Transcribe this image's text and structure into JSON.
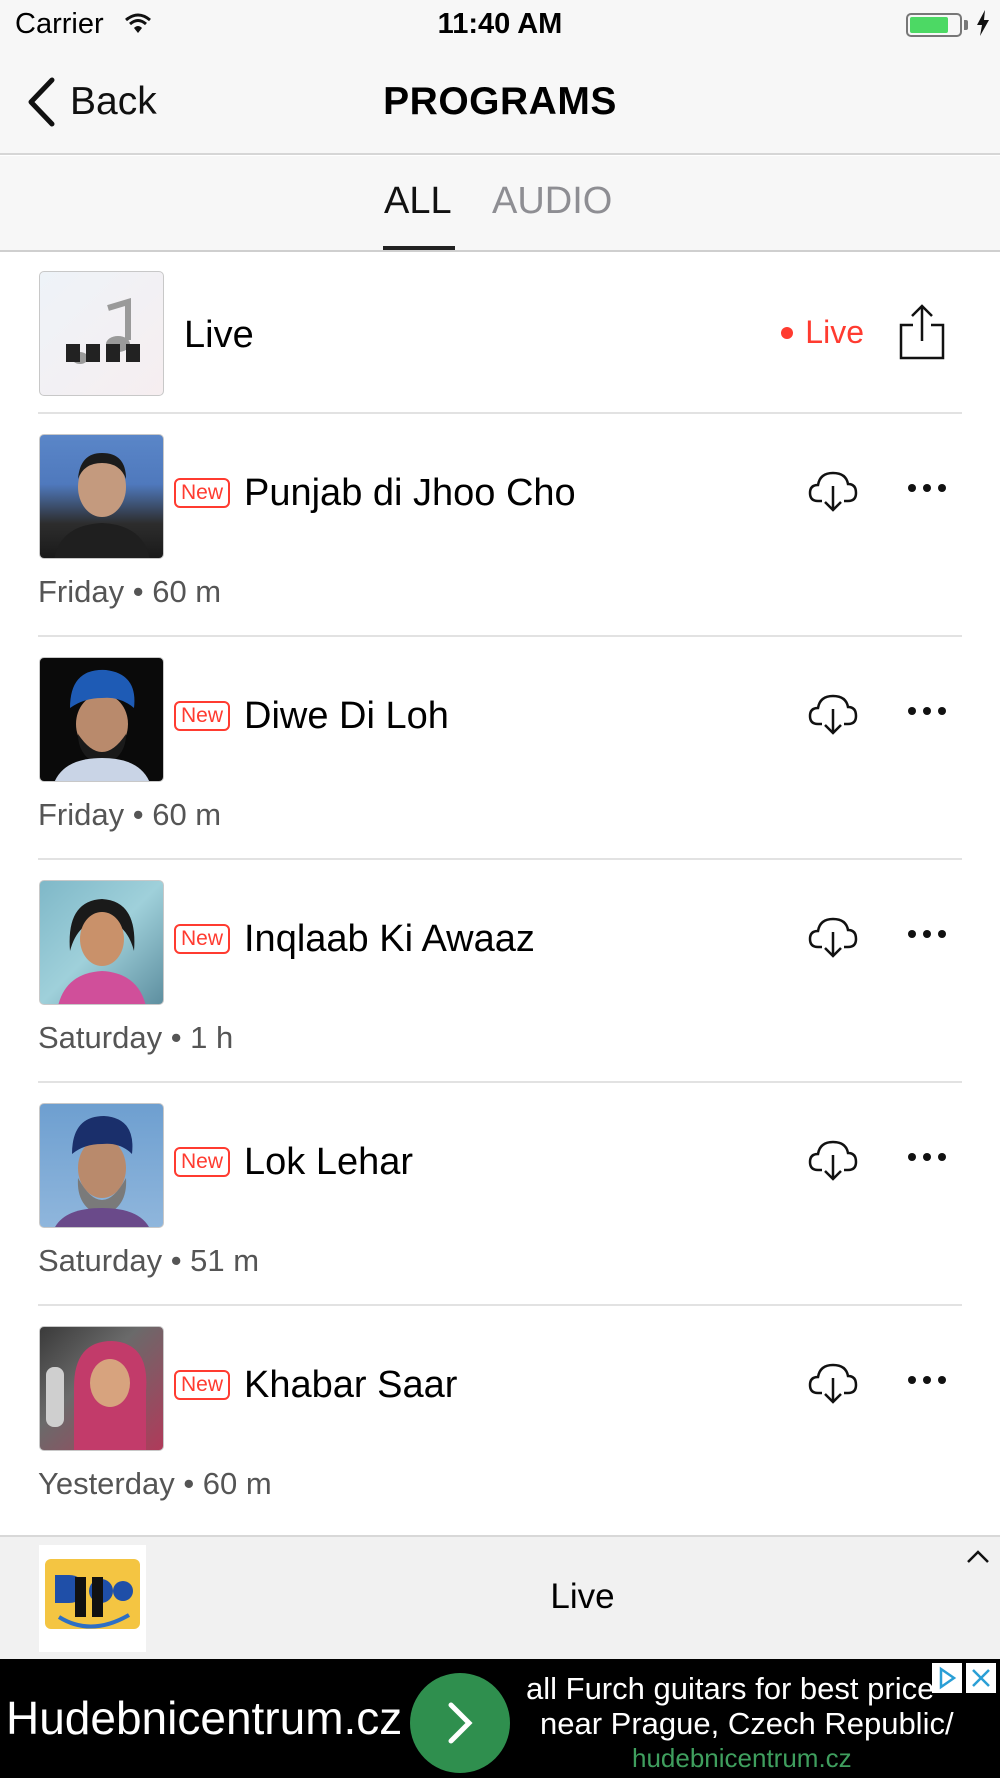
{
  "status_bar": {
    "carrier": "Carrier",
    "time": "11:40 AM",
    "battery_level": 0.8
  },
  "nav": {
    "back_label": "Back",
    "title": "PROGRAMS"
  },
  "tabs": [
    {
      "label": "ALL",
      "selected": true
    },
    {
      "label": "AUDIO",
      "selected": false
    }
  ],
  "live_item": {
    "title": "Live",
    "status": "Live"
  },
  "programs": [
    {
      "badge": "New",
      "title": "Punjab di Jhoo Cho",
      "meta": "Friday • 60 m"
    },
    {
      "badge": "New",
      "title": "Diwe Di Loh",
      "meta": "Friday • 60 m"
    },
    {
      "badge": "New",
      "title": "Inqlaab Ki Awaaz",
      "meta": "Saturday • 1 h"
    },
    {
      "badge": "New",
      "title": "Lok Lehar",
      "meta": "Saturday • 51 m"
    },
    {
      "badge": "New",
      "title": "Khabar Saar",
      "meta": "Yesterday • 60 m"
    }
  ],
  "player": {
    "title": "Live",
    "state": "paused"
  },
  "ad": {
    "site": "Hudebnicentrum.cz",
    "line1": "all Furch guitars for best price",
    "line2": "near Prague, Czech Republic/",
    "domain": "hudebnicentrum.cz"
  },
  "colors": {
    "accent_red": "#ff3b30",
    "ad_green": "#2f8f4e"
  }
}
